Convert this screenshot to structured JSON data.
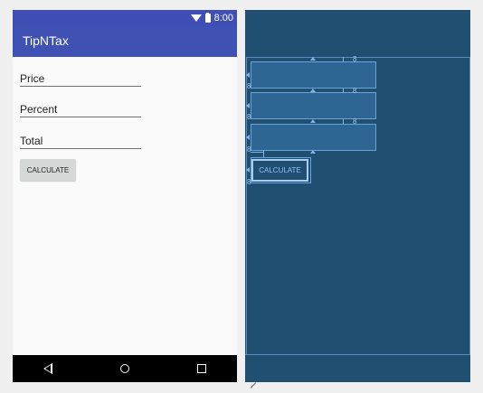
{
  "status_bar": {
    "time": "8:00",
    "icons": [
      "wifi-icon",
      "battery-icon"
    ]
  },
  "app_bar": {
    "title": "TipNTax"
  },
  "fields": [
    {
      "placeholder": "Price",
      "value": ""
    },
    {
      "placeholder": "Percent",
      "value": ""
    },
    {
      "placeholder": "Total",
      "value": ""
    }
  ],
  "calculate_button": {
    "label": "CALCULATE"
  },
  "blueprint": {
    "button_label": "CALCULATE",
    "margin_label": "8"
  },
  "nav_bar": {
    "icons": [
      "back-icon",
      "home-icon",
      "recents-icon"
    ]
  },
  "colors": {
    "primary": "#4051b4",
    "primary_dark": "#3f4fb5",
    "blueprint_bg": "#204f72",
    "blueprint_accent": "#5b9bd5"
  }
}
